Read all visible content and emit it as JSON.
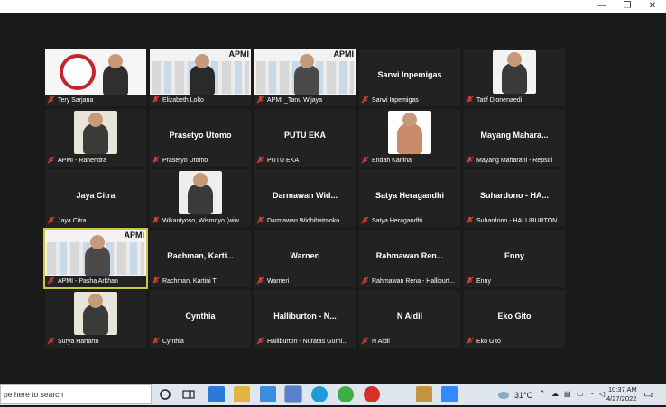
{
  "window": {
    "minimize": "—",
    "restore": "❐",
    "close": "✕"
  },
  "tiles": [
    {
      "name": "Tery Sarjana",
      "kind": "video",
      "big": ""
    },
    {
      "name": "Elizabeth Lolto",
      "kind": "video",
      "big": ""
    },
    {
      "name": "APMI _Tanu Wijaya",
      "kind": "video",
      "big": ""
    },
    {
      "name": "Sarwi Inpemigas",
      "kind": "name",
      "big": "Sarwi Inpemigas"
    },
    {
      "name": "Tatif Djonenaedi",
      "kind": "video",
      "big": ""
    },
    {
      "name": "APMI - Rahendra",
      "kind": "video",
      "big": ""
    },
    {
      "name": "Prasetyo Utomo",
      "kind": "name",
      "big": "Prasetyo Utomo"
    },
    {
      "name": "PUTU EKA",
      "kind": "name",
      "big": "PUTU EKA"
    },
    {
      "name": "Endah Karlina",
      "kind": "video",
      "big": ""
    },
    {
      "name": "Mayang Maharani - Repsol",
      "kind": "name",
      "big": "Mayang  Mahara..."
    },
    {
      "name": "Jaya Citra",
      "kind": "name",
      "big": "Jaya Citra"
    },
    {
      "name": "Wikantyoso, Wismoyo (wiw...",
      "kind": "video",
      "big": ""
    },
    {
      "name": "Darmawan Widhihatmoko",
      "kind": "name",
      "big": "Darmawan  Wid..."
    },
    {
      "name": "Satya Heragandhi",
      "kind": "name",
      "big": "Satya Heragandhi"
    },
    {
      "name": "Suhardono - HALLIBURTON",
      "kind": "name",
      "big": "Suhardono - HA..."
    },
    {
      "name": "APMI - Pasha Arkhan",
      "kind": "video",
      "big": ""
    },
    {
      "name": "Rachman, Kartini T",
      "kind": "name",
      "big": "Rachman,  Karti..."
    },
    {
      "name": "Warneri",
      "kind": "name",
      "big": "Warneri"
    },
    {
      "name": "Rahmawan Rena - Halliburt...",
      "kind": "name",
      "big": "Rahmawan  Ren..."
    },
    {
      "name": "Enny",
      "kind": "name",
      "big": "Enny"
    },
    {
      "name": "Surya Hartarto",
      "kind": "video",
      "big": ""
    },
    {
      "name": "Cynthia",
      "kind": "name",
      "big": "Cynthia"
    },
    {
      "name": "Halliburton - Nuratas Gurni...",
      "kind": "name",
      "big": "Halliburton  -  N..."
    },
    {
      "name": "N Aidil",
      "kind": "name",
      "big": "N Aidil"
    },
    {
      "name": "Eko Gito",
      "kind": "name",
      "big": "Eko Gito"
    }
  ],
  "banner_text": "APMI",
  "taskbar": {
    "search_placeholder": "pe here to search",
    "weather": "31°C",
    "time": "10:37 AM",
    "date": "4/27/2022",
    "notif_count": "2"
  },
  "colors": {
    "accent": "#c9c93a",
    "mic_muted": "#e0433a",
    "tile_bg": "#222222"
  }
}
